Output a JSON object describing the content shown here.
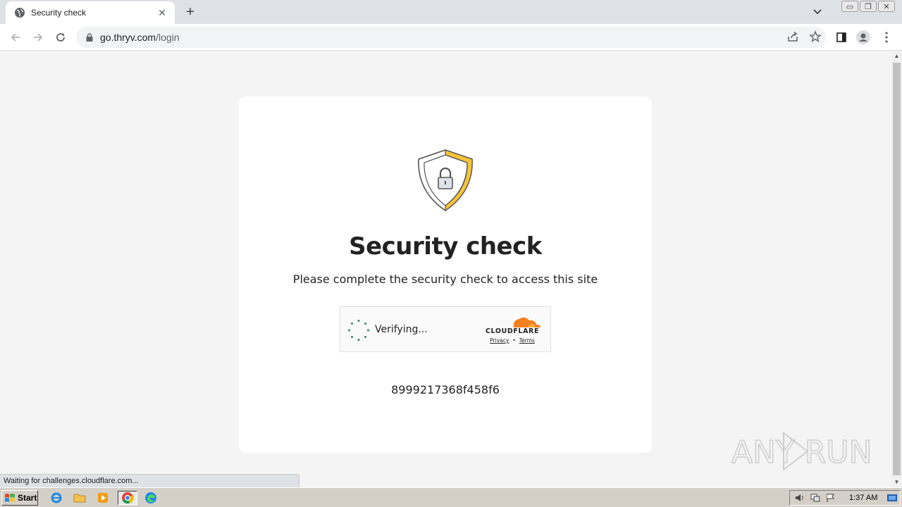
{
  "browser": {
    "tab": {
      "title": "Security check"
    },
    "url": {
      "host": "go.thryv.com",
      "path": "/login"
    }
  },
  "page": {
    "title": "Security check",
    "subtitle": "Please complete the security check to access this site",
    "widget": {
      "status": "Verifying...",
      "brand": "CLOUDFLARE",
      "privacy_link": "Privacy",
      "separator": "•",
      "terms_link": "Terms"
    },
    "ray_id": "8999217368f458f6"
  },
  "watermark": "ANY RUN",
  "status_bar": "Waiting for challenges.cloudflare.com...",
  "taskbar": {
    "start_label": "Start",
    "clock": "1:37 AM"
  },
  "colors": {
    "shield_gold": "#f6c339",
    "cloudflare_orange": "#f38020",
    "spinner_green": "#2e8b57"
  }
}
